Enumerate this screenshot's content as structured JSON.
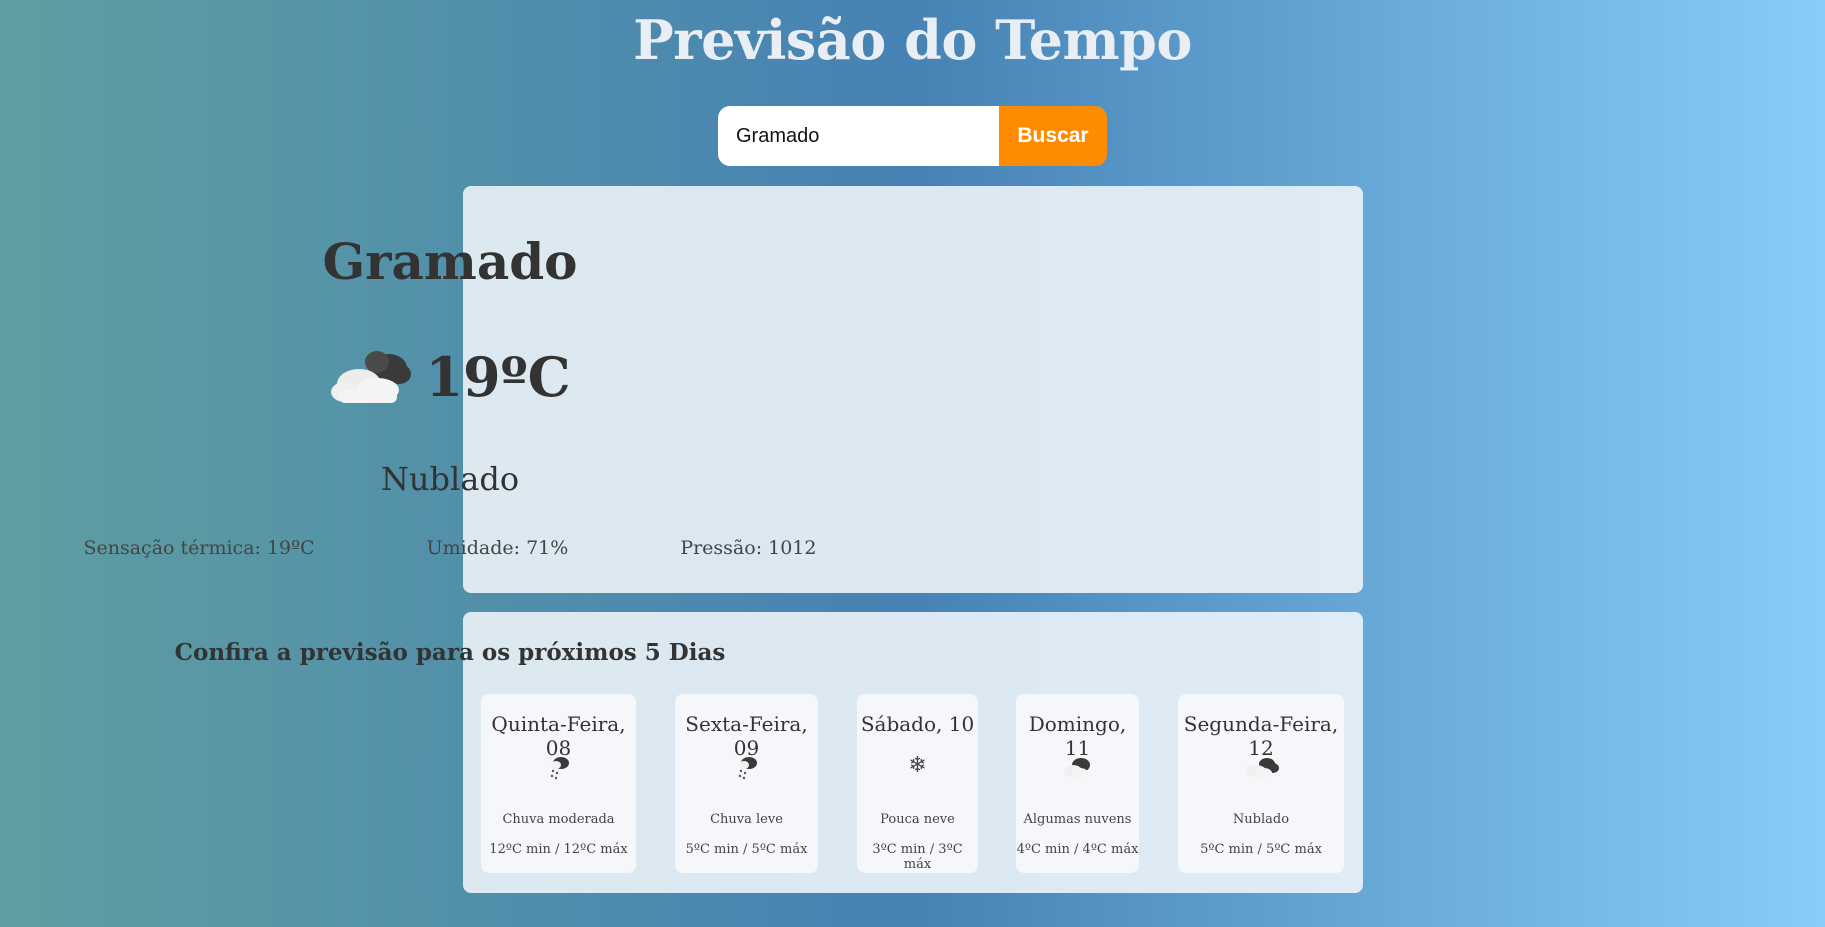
{
  "page": {
    "title": "Previsão do Tempo"
  },
  "search": {
    "value": "Gramado",
    "button_label": "Buscar"
  },
  "current": {
    "city": "Gramado",
    "icon": "cloudy-icon",
    "temperature": "19ºC",
    "description": "Nublado",
    "feels_like": "Sensação térmica: 19ºC",
    "humidity": "Umidade: 71%",
    "pressure": "Pressão: 1012"
  },
  "forecast": {
    "title": "Confira a previsão para os próximos 5 Dias",
    "days": [
      {
        "name": "Quinta-Feira, 08",
        "icon": "rain-icon",
        "description": "Chuva moderada",
        "temps": "12ºC min / 12ºC máx"
      },
      {
        "name": "Sexta-Feira, 09",
        "icon": "rain-icon",
        "description": "Chuva leve",
        "temps": "5ºC min / 5ºC máx"
      },
      {
        "name": "Sábado, 10",
        "icon": "snow-icon",
        "description": "Pouca neve",
        "temps": "3ºC min / 3ºC máx"
      },
      {
        "name": "Domingo, 11",
        "icon": "partly-cloudy-icon",
        "description": "Algumas nuvens",
        "temps": "4ºC min / 4ºC máx"
      },
      {
        "name": "Segunda-Feira, 12",
        "icon": "cloudy-icon",
        "description": "Nublado",
        "temps": "5ºC min / 5ºC máx"
      }
    ]
  },
  "colors": {
    "button": "#ff8c00",
    "title": "#e8eef3",
    "text": "#333333"
  }
}
